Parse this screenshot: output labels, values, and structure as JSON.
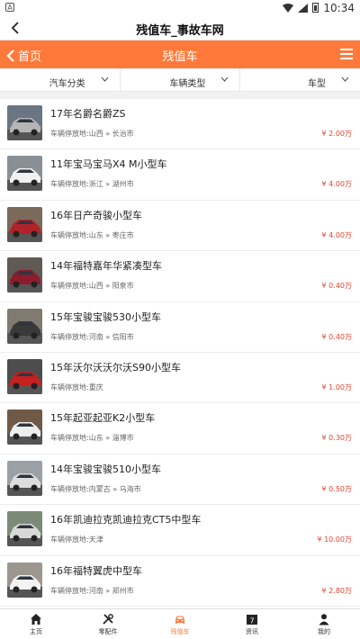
{
  "status_bar": {
    "left_icon": "A",
    "time": "10:34"
  },
  "app_title": "残值车_事故车网",
  "header": {
    "home_label": "首页",
    "page_title": "残值车"
  },
  "filters": [
    {
      "label": "汽车分类"
    },
    {
      "label": "车辆类型"
    },
    {
      "label": "车型"
    }
  ],
  "colors": {
    "accent": "#ff7a3a",
    "price": "#e8432e"
  },
  "listings": [
    {
      "name": "17年名爵名爵ZS",
      "location": "车辆停放地:山西 » 长治市",
      "price": "¥ 2.00万",
      "car_color": "#b5b5b5",
      "bg": "#6b7683"
    },
    {
      "name": "11年宝马宝马X4 M小型车",
      "location": "车辆停放地:浙江 » 湖州市",
      "price": "¥ 4.00万",
      "car_color": "#f0f0f0",
      "bg": "#8a8f95"
    },
    {
      "name": "16年日产奇骏小型车",
      "location": "车辆停放地:山东 » 枣庄市",
      "price": "¥ 4.00万",
      "car_color": "#b0232a",
      "bg": "#7a6a5a"
    },
    {
      "name": "14年福特嘉年华紧凑型车",
      "location": "车辆停放地:山西 » 阳泉市",
      "price": "¥ 0.40万",
      "car_color": "#8c1c2c",
      "bg": "#5f5a55"
    },
    {
      "name": "15年宝骏宝骏530小型车",
      "location": "车辆停放地:河南 » 信阳市",
      "price": "¥ 0.40万",
      "car_color": "#3a3a3a",
      "bg": "#807a70"
    },
    {
      "name": "15年沃尔沃沃尔沃S90小型车",
      "location": "车辆停放地:重庆",
      "price": "¥ 1.00万",
      "car_color": "#c62020",
      "bg": "#4d4d4d"
    },
    {
      "name": "15年起亚起亚K2小型车",
      "location": "车辆停放地:山东 » 淄博市",
      "price": "¥ 0.30万",
      "car_color": "#eeeeee",
      "bg": "#6f5a48"
    },
    {
      "name": "14年宝骏宝骏510小型车",
      "location": "车辆停放地:内蒙古 » 乌海市",
      "price": "¥ 0.50万",
      "car_color": "#dcdcdc",
      "bg": "#9aa0a6"
    },
    {
      "name": "16年凯迪拉克凯迪拉克CT5中型车",
      "location": "车辆停放地:天津",
      "price": "¥ 10.00万",
      "car_color": "#d8d8d8",
      "bg": "#7c8a78"
    },
    {
      "name": "16年福特翼虎中型车",
      "location": "车辆停放地:河南 » 郑州市",
      "price": "¥ 2.80万",
      "car_color": "#f2f2f2",
      "bg": "#9c9690"
    }
  ],
  "tabs": [
    {
      "label": "主页",
      "icon": "home-icon"
    },
    {
      "label": "零配件",
      "icon": "tools-icon"
    },
    {
      "label": "残值车",
      "icon": "car-icon"
    },
    {
      "label": "资讯",
      "icon": "calendar-icon"
    },
    {
      "label": "我的",
      "icon": "user-icon"
    }
  ],
  "calendar_day": "7"
}
